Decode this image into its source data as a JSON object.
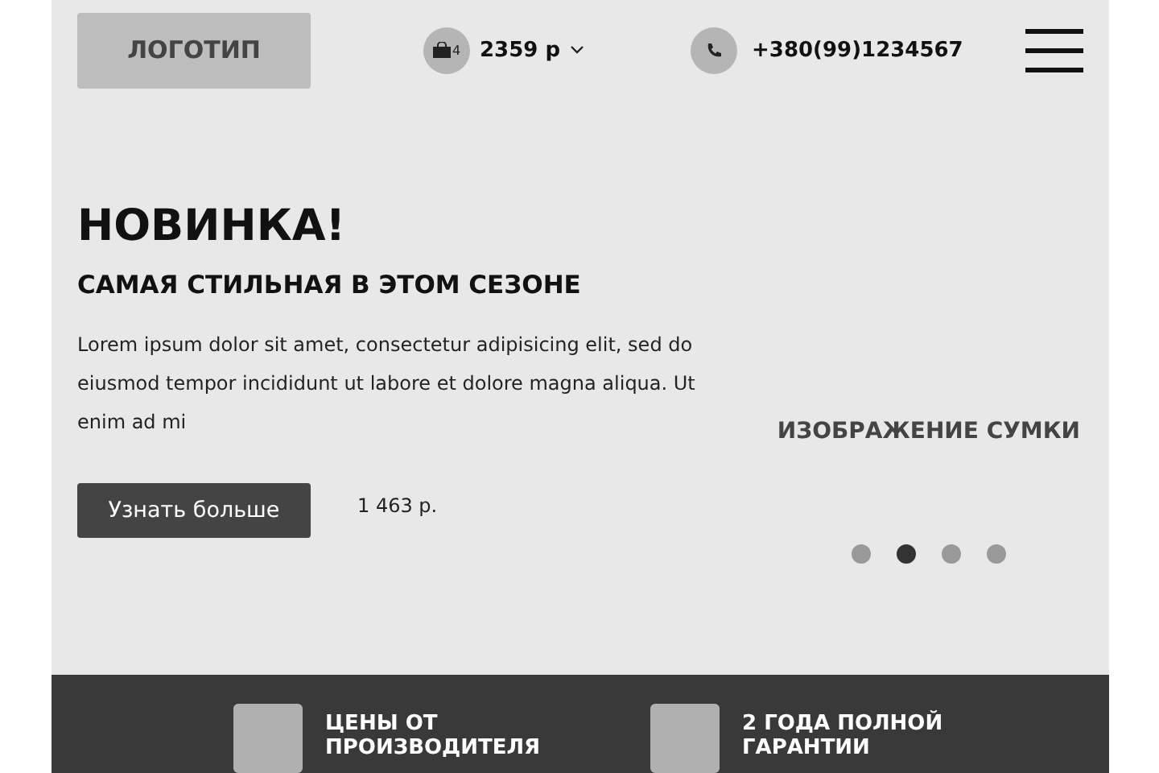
{
  "header": {
    "logo": "ЛОГОТИП",
    "cart": {
      "count": "4",
      "total": "2359 р"
    },
    "phone": "+380(99)1234567"
  },
  "hero": {
    "title": "НОВИНКА!",
    "subtitle": "САМАЯ СТИЛЬНАЯ В ЭТОМ СЕЗОНЕ",
    "text": "Lorem ipsum dolor sit amet, consectetur adipisicing elit, sed do eiusmod tempor incididunt ut labore et dolore magna aliqua. Ut enim ad mi",
    "button": "Узнать больше",
    "price": "1 463 р.",
    "image_label": "ИЗОБРАЖЕНИЕ СУМКИ",
    "slides": [
      {
        "selected": false
      },
      {
        "selected": true
      },
      {
        "selected": false
      },
      {
        "selected": false
      }
    ]
  },
  "features": [
    {
      "label": "ЦЕНЫ ОТ ПРОИЗВОДИТЕЛЯ"
    },
    {
      "label": "2 ГОДА ПОЛНОЙ ГАРАНТИИ"
    }
  ]
}
